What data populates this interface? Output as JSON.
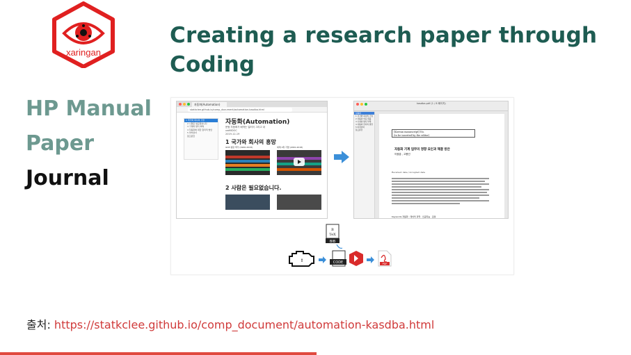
{
  "logo": {
    "text": "xaringan"
  },
  "title": "Creating a research paper through Coding",
  "nav": {
    "items": [
      {
        "label": "HP Manual",
        "active": false
      },
      {
        "label": "Paper",
        "active": false
      },
      {
        "label": "Journal",
        "active": true
      }
    ]
  },
  "screenshot": {
    "browser": {
      "tab": "자동화(Automation)",
      "url": "statkclee.github.io/comp_document/automation-kasdba.html",
      "toc": [
        "1 국가와 회사의 흥망",
        "2 시행은 필요없습니다",
        "3 기계화 방지 부족",
        "4 자동화에 대한 합리적 방안",
        "5 마치면서",
        "참고문헌"
      ],
      "heading": "자동화(Automation)",
      "meta1": "문동 자동화가 배약는 일러이 그리고 내",
      "meta2": "xwMIDOC",
      "date": "2019-12-19",
      "section1": "1 국가와 회사의 흥망",
      "section2": "2 사람은 필요없습니다.",
      "cap1": "GDP 성장 국가 (1960-2018)",
      "cap2": "세계 1위 기업 (2000-2018)"
    },
    "editor": {
      "window_title": "kasdba.pdf (1 / 8 페이지)",
      "toc": [
        "자동화",
        "1 국가와 회사의 흥망",
        "2 자동화 필요 없음",
        "3 기계화 방지 부족",
        "4 자동화 합리적 방안",
        "5 마치면서",
        "참고문헌"
      ],
      "box_line1": "[Korean manuscript] No.",
      "box_line2": "(to be inserted by the editor)",
      "paper_title": "자동화 기계 업무의 영향 요인과 해결 방안",
      "authors": "이광춘 , 고용선",
      "received": "Received: date / Accepted: date",
      "keywords": "Keywords 자동화 · 데이터 과학 · 인공지능 · 로봇"
    },
    "flow": {
      "bibtex": "BIB",
      "code": "CODE",
      "pdf": "PDF"
    }
  },
  "source": {
    "label": "출처: ",
    "url": "https://statkclee.github.io/comp_document/automation-kasdba.html"
  },
  "colors": {
    "title": "#1e5c52",
    "nav_dim": "#6d9990",
    "nav_active": "#111111",
    "accent_red": "#e04a3f",
    "link": "#d03a3a"
  }
}
